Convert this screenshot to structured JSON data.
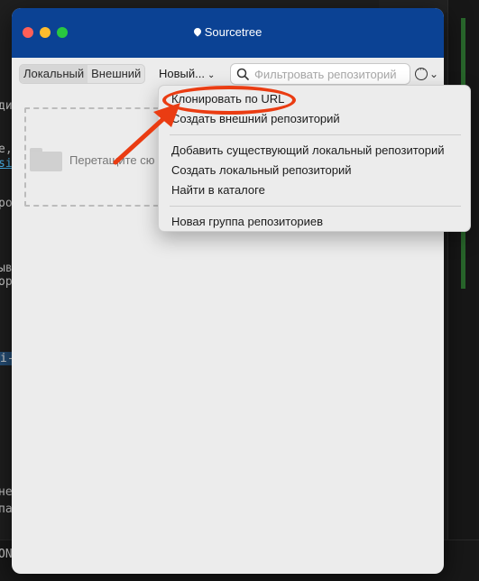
{
  "background": {
    "left_fragments": [
      "ди",
      "е,",
      "si",
      "ро",
      "ыв",
      "ор",
      "i-",
      "не",
      "па",
      "ON"
    ]
  },
  "window": {
    "title": "Sourcetree",
    "tabs": [
      {
        "label": "Локальный",
        "active": true
      },
      {
        "label": "Внешний",
        "active": false
      }
    ],
    "new_button": {
      "label": "Новый...",
      "chevron": "chevron-down-icon"
    },
    "search": {
      "placeholder": "Фильтровать репозиторий",
      "value": ""
    },
    "more_button": {
      "icon": "ellipsis-circle-icon",
      "chevron": "chevron-down-icon"
    },
    "dropzone": {
      "text": "Перетащите сю"
    }
  },
  "menu": {
    "items": [
      {
        "label": "Клонировать по URL"
      },
      {
        "label": "Создать внешний репозиторий"
      },
      {
        "label": "Добавить существующий локальный репозиторий"
      },
      {
        "label": "Создать локальный репозиторий"
      },
      {
        "label": "Найти в каталоге"
      },
      {
        "label": "Новая группа репозиториев"
      }
    ]
  },
  "annotation": {
    "color": "#ea3c12"
  },
  "colors": {
    "titlebar": "#0b4294",
    "window_bg": "#ececec",
    "traffic_close": "#ff5f57",
    "traffic_min": "#febc2e",
    "traffic_max": "#28c840"
  }
}
